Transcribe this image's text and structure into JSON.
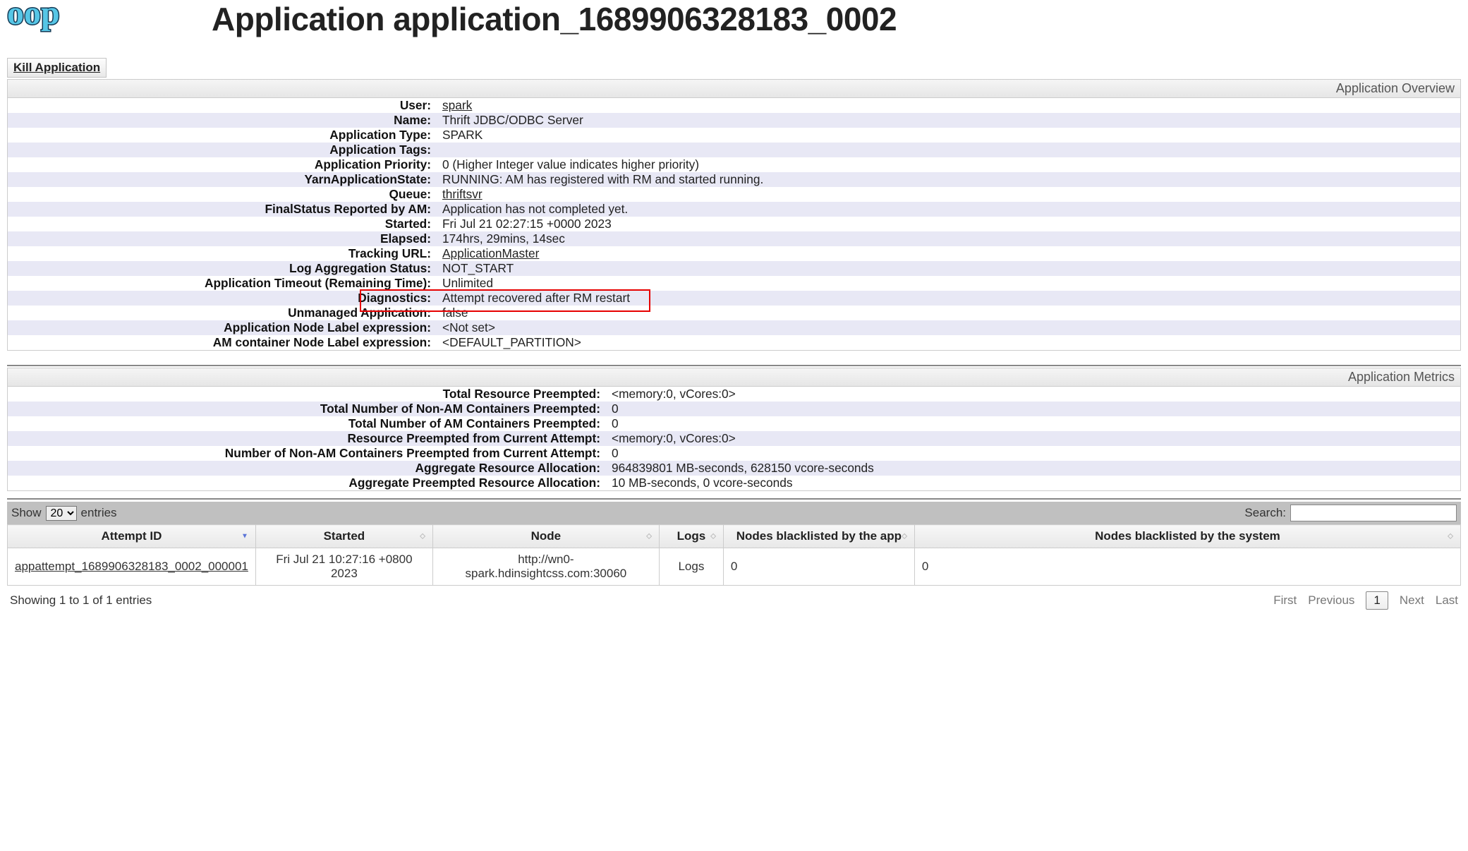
{
  "header": {
    "page_title": "Application application_1689906328183_0002",
    "kill_button": "Kill Application"
  },
  "sections": {
    "overview": {
      "title": "Application Overview",
      "items": [
        {
          "k": "User:",
          "v": "spark",
          "link": true
        },
        {
          "k": "Name:",
          "v": "Thrift JDBC/ODBC Server"
        },
        {
          "k": "Application Type:",
          "v": "SPARK"
        },
        {
          "k": "Application Tags:",
          "v": ""
        },
        {
          "k": "Application Priority:",
          "v": "0 (Higher Integer value indicates higher priority)"
        },
        {
          "k": "YarnApplicationState:",
          "v": "RUNNING: AM has registered with RM and started running."
        },
        {
          "k": "Queue:",
          "v": "thriftsvr",
          "link": true
        },
        {
          "k": "FinalStatus Reported by AM:",
          "v": "Application has not completed yet."
        },
        {
          "k": "Started:",
          "v": "Fri Jul 21 02:27:15 +0000 2023"
        },
        {
          "k": "Elapsed:",
          "v": "174hrs, 29mins, 14sec"
        },
        {
          "k": "Tracking URL:",
          "v": "ApplicationMaster",
          "link": true
        },
        {
          "k": "Log Aggregation Status:",
          "v": "NOT_START"
        },
        {
          "k": "Application Timeout (Remaining Time):",
          "v": "Unlimited"
        },
        {
          "k": "Diagnostics:",
          "v": "Attempt recovered after RM restart",
          "highlight": true
        },
        {
          "k": "Unmanaged Application:",
          "v": "false"
        },
        {
          "k": "Application Node Label expression:",
          "v": "<Not set>"
        },
        {
          "k": "AM container Node Label expression:",
          "v": "<DEFAULT_PARTITION>"
        }
      ]
    },
    "metrics": {
      "title": "Application Metrics",
      "items": [
        {
          "k": "Total Resource Preempted:",
          "v": "<memory:0, vCores:0>"
        },
        {
          "k": "Total Number of Non-AM Containers Preempted:",
          "v": "0"
        },
        {
          "k": "Total Number of AM Containers Preempted:",
          "v": "0"
        },
        {
          "k": "Resource Preempted from Current Attempt:",
          "v": "<memory:0, vCores:0>"
        },
        {
          "k": "Number of Non-AM Containers Preempted from Current Attempt:",
          "v": "0"
        },
        {
          "k": "Aggregate Resource Allocation:",
          "v": "964839801 MB-seconds, 628150 vcore-seconds"
        },
        {
          "k": "Aggregate Preempted Resource Allocation:",
          "v": "10 MB-seconds, 0 vcore-seconds"
        }
      ]
    }
  },
  "table": {
    "show_label": "Show",
    "entries_label": "entries",
    "page_length_selected": "20",
    "search_label": "Search:",
    "search_value": "",
    "columns": [
      "Attempt ID",
      "Started",
      "Node",
      "Logs",
      "Nodes blacklisted by the app",
      "Nodes blacklisted by the system"
    ],
    "rows": [
      {
        "attempt_id": "appattempt_1689906328183_0002_000001",
        "started": "Fri Jul 21 10:27:16 +0800 2023",
        "node": "http://wn0-spark.hdinsightcss.com:30060",
        "logs": "Logs",
        "bl_app": "0",
        "bl_sys": "0"
      }
    ],
    "info_text": "Showing 1 to 1 of 1 entries",
    "pager": {
      "first": "First",
      "prev": "Previous",
      "current": "1",
      "next": "Next",
      "last": "Last"
    }
  }
}
